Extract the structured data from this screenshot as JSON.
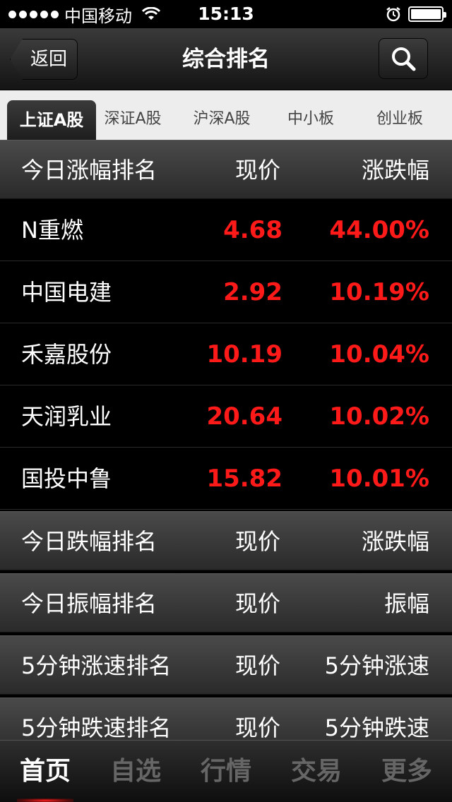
{
  "status_bar": {
    "carrier": "中国移动",
    "time": "15:13"
  },
  "nav": {
    "back_label": "返回",
    "title": "综合排名"
  },
  "tabs": [
    {
      "label": "上证A股",
      "active": true
    },
    {
      "label": "深证A股",
      "active": false
    },
    {
      "label": "沪深A股",
      "active": false
    },
    {
      "label": "中小板",
      "active": false
    },
    {
      "label": "创业板",
      "active": false
    }
  ],
  "sections": {
    "gain": {
      "title": "今日涨幅排名",
      "col2": "现价",
      "col3": "涨跌幅"
    },
    "loss": {
      "title": "今日跌幅排名",
      "col2": "现价",
      "col3": "涨跌幅"
    },
    "amplitude": {
      "title": "今日振幅排名",
      "col2": "现价",
      "col3": "振幅"
    },
    "speed_up": {
      "title": "5分钟涨速排名",
      "col2": "现价",
      "col3": "5分钟涨速"
    },
    "speed_down": {
      "title": "5分钟跌速排名",
      "col2": "现价",
      "col3": "5分钟跌速"
    }
  },
  "gain_rows": [
    {
      "name": "N重燃",
      "price": "4.68",
      "change": "44.00%"
    },
    {
      "name": "中国电建",
      "price": "2.92",
      "change": "10.19%"
    },
    {
      "name": "禾嘉股份",
      "price": "10.19",
      "change": "10.04%"
    },
    {
      "name": "天润乳业",
      "price": "20.64",
      "change": "10.02%"
    },
    {
      "name": "国投中鲁",
      "price": "15.82",
      "change": "10.01%"
    }
  ],
  "bottom_tabs": [
    {
      "label": "首页",
      "active": true
    },
    {
      "label": "自选",
      "active": false
    },
    {
      "label": "行情",
      "active": false
    },
    {
      "label": "交易",
      "active": false
    },
    {
      "label": "更多",
      "active": false
    }
  ],
  "colors": {
    "up": "#ff1a1a",
    "header_bg": "#3a3a3a",
    "tab_bg": "#ededed"
  }
}
